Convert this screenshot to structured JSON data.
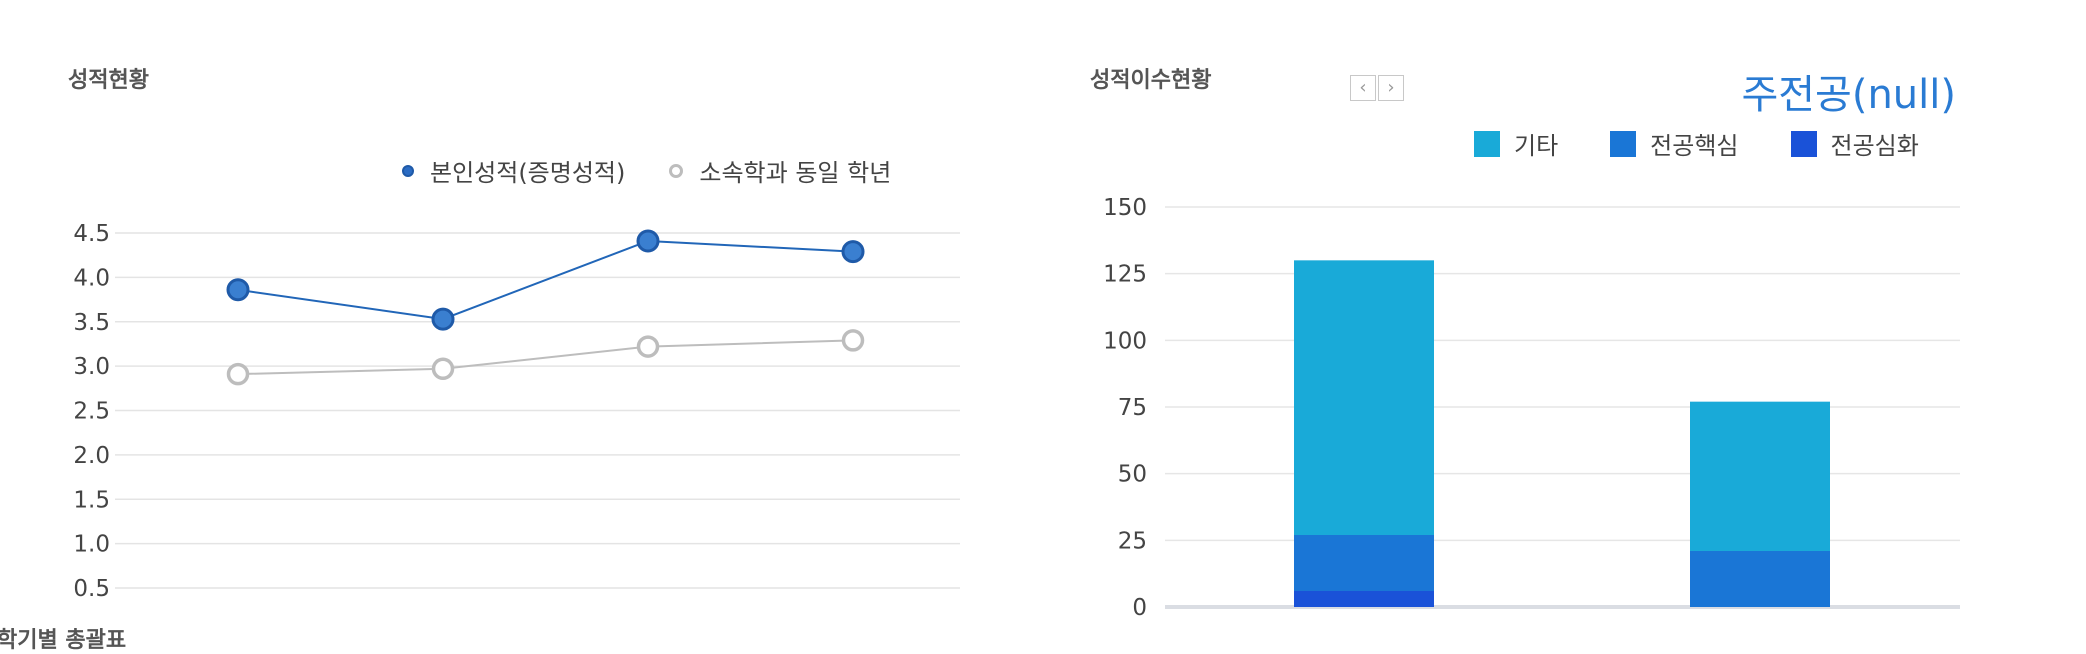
{
  "left_panel": {
    "title": "성적현황",
    "legend": [
      {
        "label": "본인성적(증명성적)",
        "color": "#2b6cc4"
      },
      {
        "label": "소속학과 동일 학년",
        "color": "#bdbdbd"
      }
    ]
  },
  "right_panel": {
    "title": "성적이수현황",
    "major_title": "주전공(null)",
    "nav": {
      "prev_icon": "chevron-left-icon",
      "next_icon": "chevron-right-icon"
    },
    "legend": [
      {
        "label": "기타",
        "color": "#19aad8"
      },
      {
        "label": "전공핵심",
        "color": "#1a76d6"
      },
      {
        "label": "전공심화",
        "color": "#1a52d8"
      }
    ]
  },
  "bottom_panel": {
    "title": "학기별 총괄표"
  },
  "chart_data": [
    {
      "type": "line",
      "title": "성적현황",
      "x": [
        1,
        2,
        3,
        4
      ],
      "ylim": [
        0.5,
        4.5
      ],
      "y_ticks": [
        "0.5",
        "1.0",
        "1.5",
        "2.0",
        "2.5",
        "3.0",
        "3.5",
        "4.0",
        "4.5"
      ],
      "grid": true,
      "legend_position": "top",
      "series": [
        {
          "name": "본인성적(증명성적)",
          "values": [
            3.86,
            3.53,
            4.41,
            4.29
          ],
          "color": "#2b6cc4"
        },
        {
          "name": "소속학과 동일 학년",
          "values": [
            2.91,
            2.97,
            3.22,
            3.29
          ],
          "color": "#bdbdbd"
        }
      ]
    },
    {
      "type": "bar",
      "stacked": true,
      "title": "성적이수현황",
      "categories": [
        "",
        ""
      ],
      "ylim": [
        0,
        150
      ],
      "y_ticks": [
        "0",
        "25",
        "50",
        "75",
        "100",
        "125",
        "150"
      ],
      "grid": true,
      "legend_position": "top-right",
      "series": [
        {
          "name": "전공심화",
          "values": [
            6,
            0
          ],
          "color": "#1a52d8"
        },
        {
          "name": "전공핵심",
          "values": [
            21,
            21
          ],
          "color": "#1a76d6"
        },
        {
          "name": "기타",
          "values": [
            103,
            56
          ],
          "color": "#19aad8"
        }
      ]
    }
  ]
}
